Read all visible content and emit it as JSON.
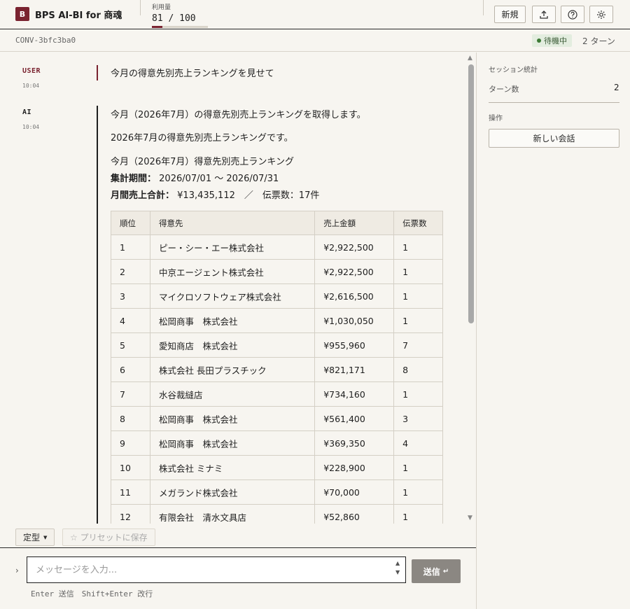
{
  "header": {
    "logo_letter": "B",
    "app_title": "BPS AI-BI for 商魂",
    "usage_label": "利用量",
    "usage_value": "81 / 100",
    "usage_fraction": 0.19,
    "buttons": {
      "new_label": "新規"
    }
  },
  "subbar": {
    "conversation_id": "CONV-3bfc3ba0",
    "status": "待機中",
    "turns": "2 ターン"
  },
  "messages": [
    {
      "role": "USER",
      "time": "10:04",
      "text": "今月の得意先別売上ランキングを見せて"
    },
    {
      "role": "AI",
      "time": "10:04",
      "lines": [
        "今月（2026年7月）の得意先別売上ランキングを取得します。",
        "2026年7月の得意先別売上ランキングです。",
        "今月（2026年7月）得意先別売上ランキング"
      ],
      "period_label": "集計期間：",
      "period_value": "2026/07/01 ～ 2026/07/31",
      "total_label": "月間売上合計：",
      "total_value": "¥13,435,112　／　伝票数：17件",
      "table": {
        "headers": [
          "順位",
          "得意先",
          "売上金額",
          "伝票数"
        ],
        "rows": [
          [
            "1",
            "ピー・シー・エー株式会社",
            "¥2,922,500",
            "1"
          ],
          [
            "2",
            "中京エージェント株式会社",
            "¥2,922,500",
            "1"
          ],
          [
            "3",
            "マイクロソフトウェア株式会社",
            "¥2,616,500",
            "1"
          ],
          [
            "4",
            "松岡商事　株式会社",
            "¥1,030,050",
            "1"
          ],
          [
            "5",
            "愛知商店　株式会社",
            "¥955,960",
            "7"
          ],
          [
            "6",
            "株式会社 長田プラスチック",
            "¥821,171",
            "8"
          ],
          [
            "7",
            "水谷裁縫店",
            "¥734,160",
            "1"
          ],
          [
            "8",
            "松岡商事　株式会社",
            "¥561,400",
            "3"
          ],
          [
            "9",
            "松岡商事　株式会社",
            "¥369,350",
            "4"
          ],
          [
            "10",
            "株式会社 ミナミ",
            "¥228,900",
            "1"
          ],
          [
            "11",
            "メガランド株式会社",
            "¥70,000",
            "1"
          ],
          [
            "12",
            "有限会社　清水文具店",
            "¥52,860",
            "1"
          ]
        ]
      }
    }
  ],
  "presets": {
    "template_label": "定型",
    "save_label": "☆ プリセットに保存"
  },
  "composer": {
    "placeholder": "メッセージを入力...",
    "send_label": "送信",
    "hint": "Enter 送信　Shift+Enter 改行"
  },
  "side_panel": {
    "stats_title": "セッション統計",
    "turns_label": "ターン数",
    "turns_value": "2",
    "actions_title": "操作",
    "new_chat_label": "新しい会話"
  },
  "colors": {
    "accent": "#7a2330",
    "background": "#f7f5f0",
    "status_bg": "#e3eddf",
    "status_dot": "#3d7a35",
    "send_button": "#8b8782"
  }
}
